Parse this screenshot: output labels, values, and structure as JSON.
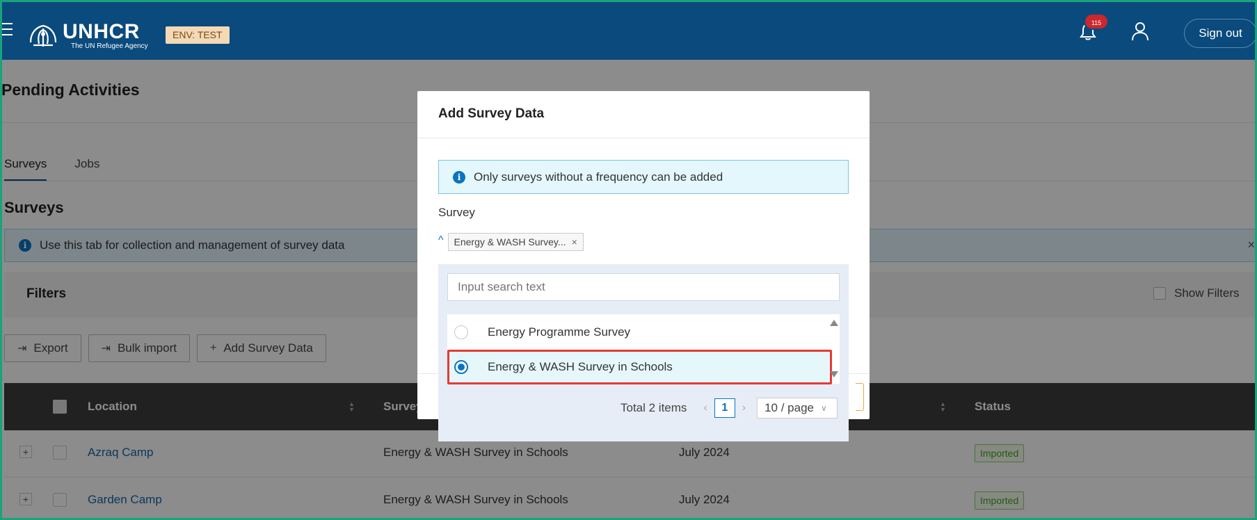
{
  "header": {
    "logo_name": "UNHCR",
    "logo_sub": "The UN Refugee Agency",
    "env_label": "ENV: TEST",
    "notifications_count": "115",
    "signout_label": "Sign out",
    "bg_color": "#0a4a7d"
  },
  "page": {
    "title": "Pending Activities",
    "tabs": [
      {
        "label": "Surveys",
        "active": true
      },
      {
        "label": "Jobs",
        "active": false
      }
    ],
    "section_title": "Surveys",
    "info_text": "Use this tab for collection and management of survey data",
    "filters_title": "Filters",
    "show_filters_label": "Show Filters",
    "actions": {
      "export": "Export",
      "bulk_import": "Bulk import",
      "add_survey": "Add Survey Data"
    }
  },
  "table": {
    "columns": {
      "location": "Location",
      "survey": "Survey",
      "status": "Status"
    },
    "rows": [
      {
        "location": "Azraq Camp",
        "survey": "Energy & WASH Survey in Schools",
        "period": "July 2024",
        "status": "Imported"
      },
      {
        "location": "Garden Camp",
        "survey": "Energy & WASH Survey in Schools",
        "period": "July 2024",
        "status": "Imported"
      }
    ]
  },
  "modal": {
    "title": "Add Survey Data",
    "info_text": "Only surveys without a frequency can be added",
    "survey_label": "Survey",
    "selected_tag": "Energy & WASH Survey...",
    "search_placeholder": "Input search text",
    "options": [
      {
        "label": "Energy Programme Survey",
        "selected": false
      },
      {
        "label": "Energy & WASH Survey in Schools",
        "selected": true
      }
    ],
    "pager": {
      "total": "Total 2 items",
      "page": "1",
      "page_size": "10 / page"
    }
  },
  "icons": {
    "menu": "hamburger-icon",
    "bell": "bell-icon",
    "user": "user-icon",
    "info": "info-icon",
    "export": "export-icon",
    "plus": "plus-icon"
  },
  "colors": {
    "accent": "#0a74c2",
    "status_green": "#46a320",
    "highlight": "#e53935"
  }
}
